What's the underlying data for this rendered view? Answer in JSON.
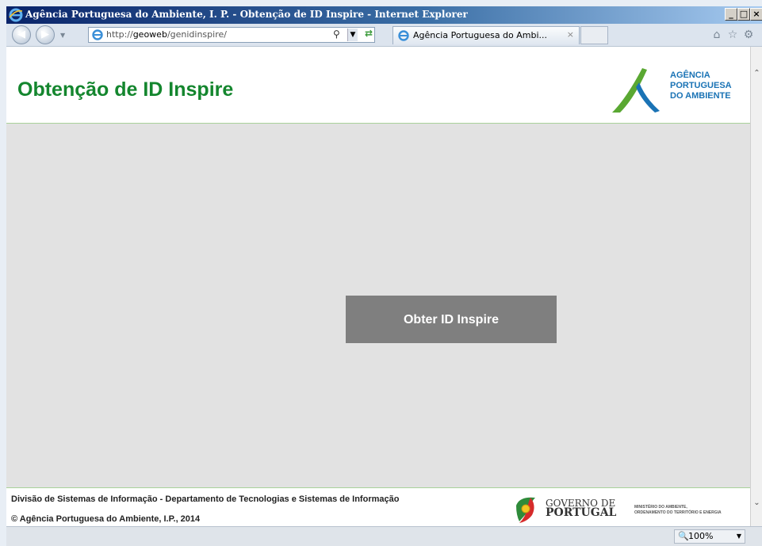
{
  "window": {
    "title": "Agência Portuguesa do Ambiente, I. P. - Obtenção de ID Inspire - Internet Explorer",
    "minimize": "_",
    "maximize": "□",
    "close": "×"
  },
  "navbar": {
    "address_prefix": "http://",
    "address_host": "geoweb",
    "address_path": "/genidinspire/",
    "search_glyph": "⚲",
    "tab_label": "Agência Portuguesa do Ambi...",
    "tab_close": "×"
  },
  "toolbar_icons": [
    "home-icon",
    "favorites-star-icon",
    "tools-gear-icon"
  ],
  "page": {
    "title": "Obtenção de ID Inspire",
    "logo_lines": [
      "AGÊNCIA",
      "PORTUGUESA",
      "DO AMBIENTE"
    ],
    "button_label": "Obter ID Inspire",
    "footer_line1": "Divisão de Sistemas de Informação - Departamento de Tecnologias e Sistemas de Informação",
    "footer_line2": "© Agência Portuguesa do Ambiente, I.P., 2014",
    "gov_line1": "GOVERNO DE",
    "gov_line2": "PORTUGAL",
    "ministry_line1": "MINISTÉRIO DO AMBIENTE,",
    "ministry_line2": "ORDENAMENTO DO TERRITÓRIO E ENERGIA"
  },
  "status": {
    "zoom": "100%"
  },
  "colors": {
    "title_green": "#14862e",
    "logo_blue": "#1a73b5",
    "button_gray": "#7f7f7f"
  }
}
